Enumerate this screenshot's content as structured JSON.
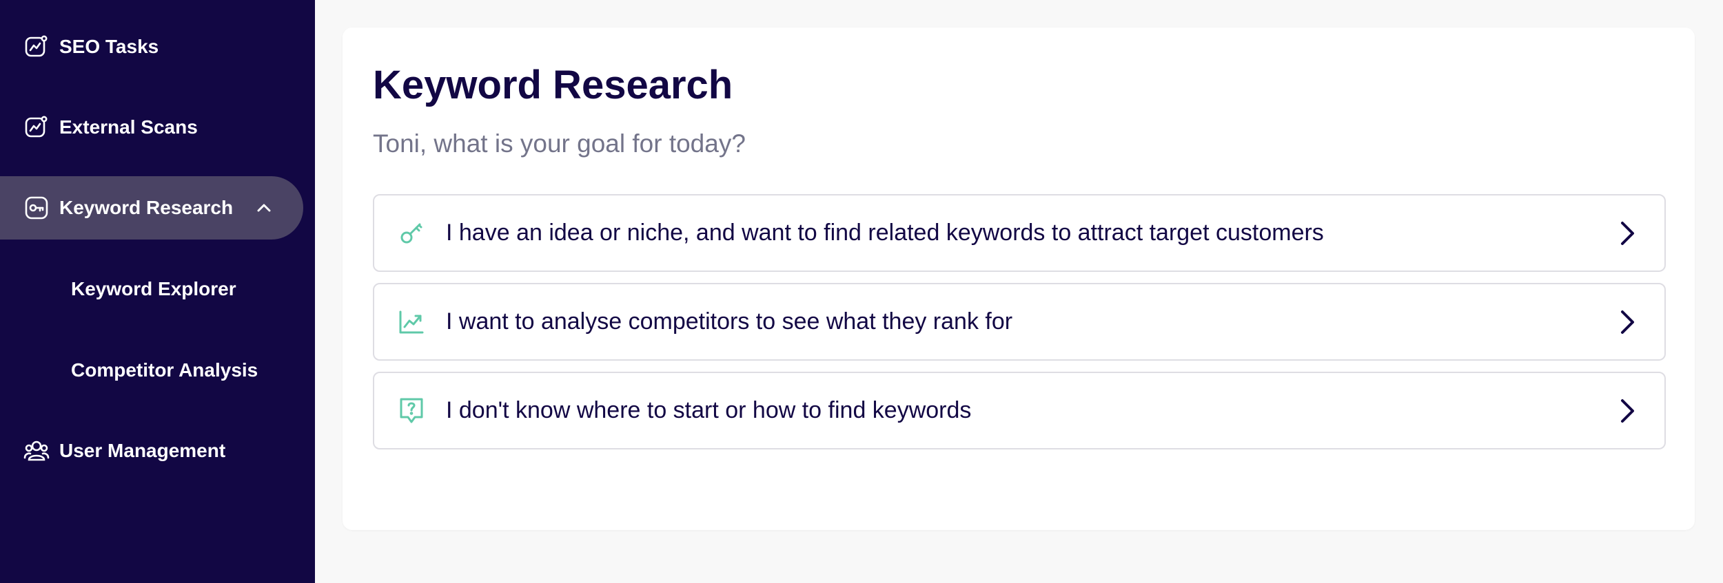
{
  "sidebar": {
    "items": [
      {
        "label": "SEO Tasks",
        "icon": "trend-card-icon"
      },
      {
        "label": "External Scans",
        "icon": "trend-card-icon"
      },
      {
        "label": "Keyword Research",
        "icon": "key-card-icon",
        "expanded": true
      },
      {
        "label": "User Management",
        "icon": "users-icon"
      }
    ],
    "subitems": [
      {
        "label": "Keyword Explorer"
      },
      {
        "label": "Competitor Analysis"
      }
    ]
  },
  "main": {
    "title": "Keyword Research",
    "subtitle": "Toni, what is your goal for today?",
    "options": [
      {
        "label": "I have an idea or niche, and want to find related keywords to attract target customers",
        "icon": "key-icon"
      },
      {
        "label": "I want to analyse competitors to see what they rank for",
        "icon": "chart-up-icon"
      },
      {
        "label": "I don't know where to start or how to find keywords",
        "icon": "question-bubble-icon"
      }
    ]
  },
  "colors": {
    "sidebar_bg": "#120744",
    "sidebar_active": "#4a4364",
    "accent_green": "#5fc9a8",
    "title": "#120744",
    "subtitle": "#73748a",
    "page_bg": "#f8f8f8"
  }
}
